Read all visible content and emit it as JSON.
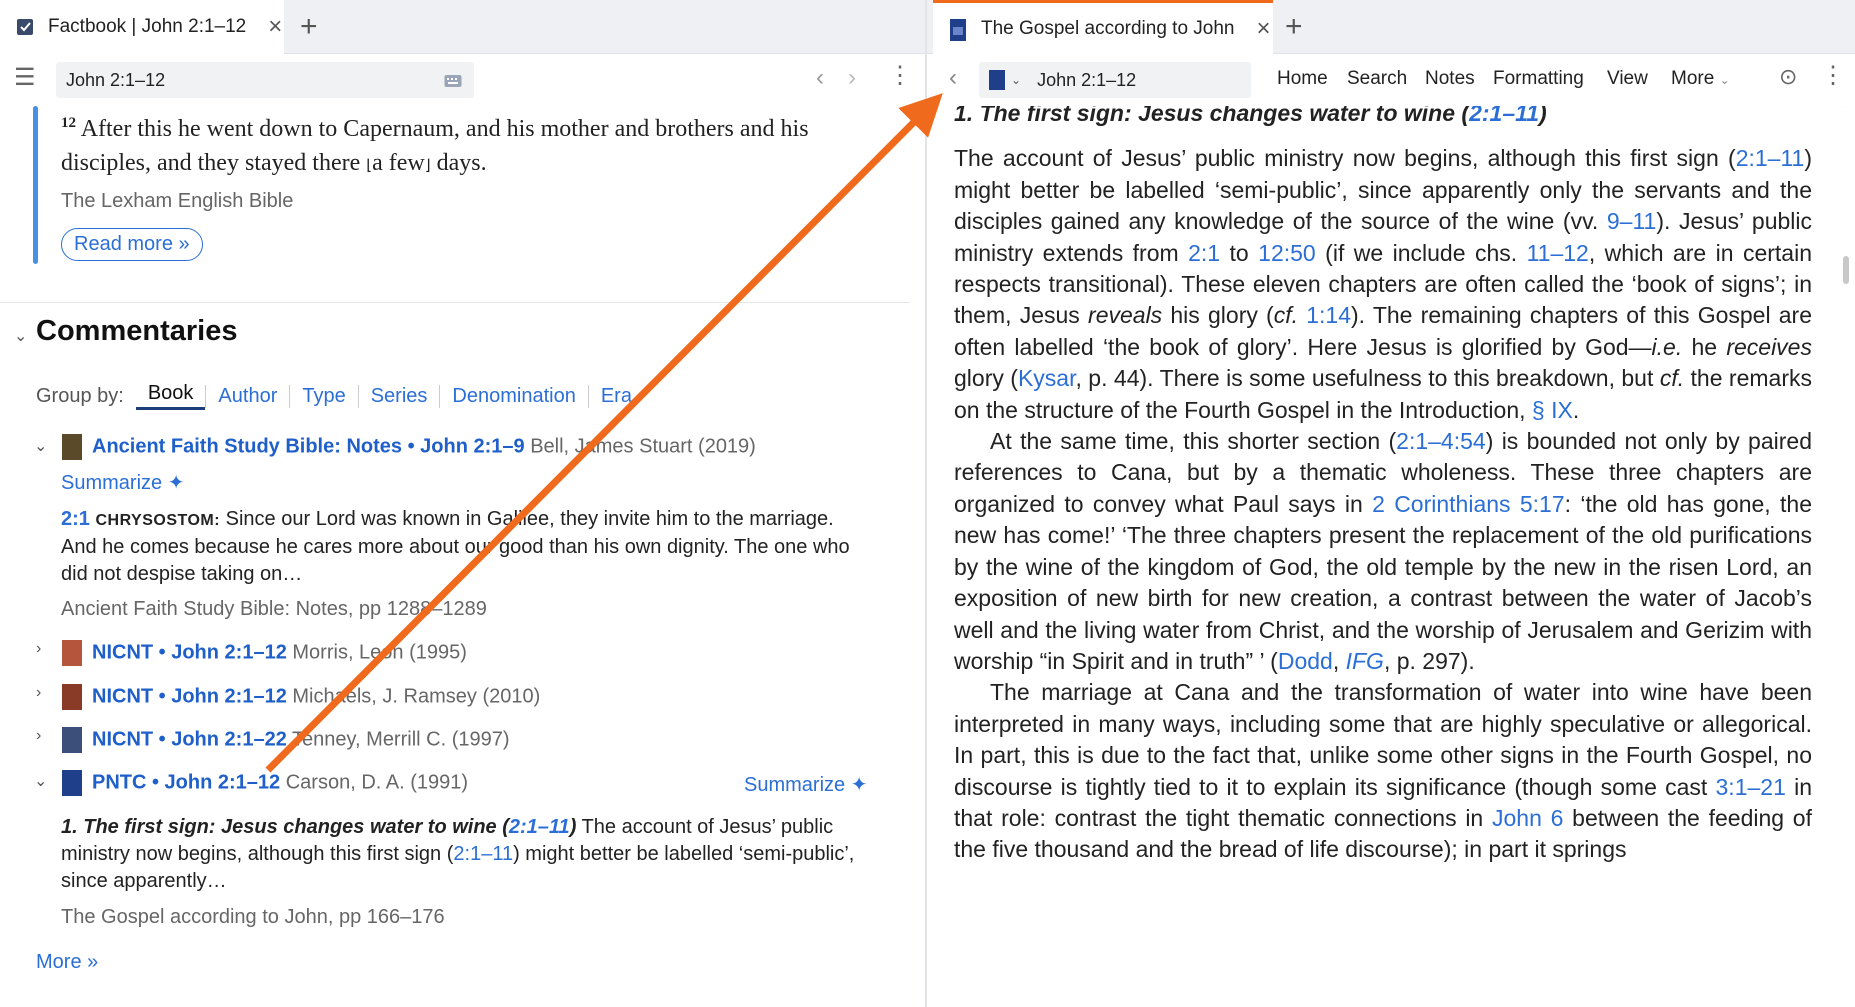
{
  "left": {
    "tab_title": "Factbook | John 2:1–12",
    "reference": "John 2:1–12",
    "verse": {
      "number": "12",
      "text_before": "After this he went down to Capernaum, and his mother and brothers and his disciples, and they stayed there ",
      "bracket_open": "⌊",
      "bracket_text": "a few",
      "bracket_close": "⌋",
      "text_after": " days.",
      "source": "The Lexham English Bible",
      "read_more": "Read more »"
    },
    "commentaries": {
      "title": "Commentaries",
      "group_by_label": "Group by:",
      "group_by_options": [
        "Book",
        "Author",
        "Type",
        "Series",
        "Denomination",
        "Era"
      ],
      "entries": [
        {
          "title": "Ancient Faith Study Bible: Notes • John 2:1–9",
          "meta": "Bell, James Stuart (2019)",
          "expanded": true
        },
        {
          "title": "NICNT • John 2:1–12",
          "meta": "Morris, Leon (1995)",
          "expanded": false
        },
        {
          "title": "NICNT • John 2:1–12",
          "meta": "Michaels, J. Ramsey (2010)",
          "expanded": false
        },
        {
          "title": "NICNT • John 2:1–22",
          "meta": "Tenney, Merrill C. (1997)",
          "expanded": false
        },
        {
          "title": "PNTC • John 2:1–12",
          "meta": "Carson, D. A. (1991)",
          "expanded": true
        }
      ],
      "summarize": "Summarize",
      "afsb_snippet": {
        "ref": "2:1",
        "author": "CHRYSOSTOM:",
        "text": " Since our Lord was known in Galilee, they invite him to the marriage. And he comes because he cares more about our good than his own dignity. The one who did not despise taking on…",
        "source": "Ancient Faith Study Bible: Notes, pp 1288–1289"
      },
      "pntc_snippet": {
        "heading": "1. The first sign: Jesus changes water to wine (",
        "heading_ref": "2:1–11",
        "heading_close": ")",
        "text_a": " The account of Jesus’ public ministry now begins, although this first sign (",
        "ref": "2:1–11",
        "text_b": ") might better be labelled ‘semi-public’, since apparently…",
        "source": "The Gospel according to John, pp 166–176"
      },
      "more": "More »"
    }
  },
  "right": {
    "tab_title": "The Gospel according to John",
    "reference": "John 2:1–12",
    "menu": [
      "Home",
      "Search",
      "Notes",
      "Formatting",
      "View",
      "More"
    ],
    "heading": "1. The first sign: Jesus changes water to wine (",
    "heading_ref": "2:1–11",
    "heading_close": ")",
    "p1": {
      "a": "The account of Jesus’ public ministry now begins, although this first sign (",
      "l1": "2:1–11",
      "b": ") might better be labelled ‘semi-public’, since apparently only the servants and the disciples gained any knowledge of the source of the wine (vv. ",
      "l2": "9–11",
      "c": "). Jesus’ public ministry extends from ",
      "l3": "2:1",
      "d": " to ",
      "l4": "12:50",
      "e": " (if we include chs. ",
      "l5": "11–12",
      "f": ", which are in certain respects transitional). These eleven chapters are often called the ‘book of signs’; in them, Jesus ",
      "i1": "reveals",
      "g": " his glory (",
      "i2": "cf.",
      "h": " ",
      "l6": "1:14",
      "i": "). The remaining chapters of this Gospel are often labelled ‘the book of glory’. Here Jesus is glorified by God—",
      "i3": "i.e.",
      "j": " he ",
      "i4": "receives",
      "k": " glory (",
      "l7": "Kysar",
      "m": ", p. 44). There is some usefulness to this breakdown, but ",
      "i5": "cf.",
      "n": " the remarks on the structure of the Fourth Gospel in the Introduction, ",
      "l8": "§ IX",
      "o": "."
    },
    "p2": {
      "a": "At the same time, this shorter section (",
      "l1": "2:1–4:54",
      "b": ") is bounded not only by paired references to Cana, but by a thematic wholeness. These three chapters are organized to convey what Paul says in ",
      "l2": "2 Corinthians 5:17",
      "c": ": ‘the old has gone, the new has come!’ ‘The three chapters present the replacement of the old purifications by the wine of the kingdom of God, the old temple by the new in the risen Lord, an exposition of new birth for new creation, a contrast between the water of Jacob’s well and the living water from Christ, and the worship of Jerusalem and Gerizim with worship “in Spirit and in truth” ’ (",
      "l3": "Dodd",
      "d": ", ",
      "l4": "IFG",
      "e": ", p. 297)."
    },
    "p3": {
      "a": "The marriage at Cana and the transformation of water into wine have been interpreted in many ways, including some that are highly speculative or allegorical. In part, this is due to the fact that, unlike some other signs in the Fourth Gospel, no discourse is tightly tied to it to explain its significance (though some cast ",
      "l1": "3:1–21",
      "b": " in that role: contrast the tight thematic connections in ",
      "l2": "John 6",
      "c": " between the feeding of the five thousand and the bread of life discourse); in part it springs"
    }
  },
  "colors": {
    "link": "#2b6fd6",
    "arrow": "#f06a1d",
    "accent": "#4a90e2"
  }
}
